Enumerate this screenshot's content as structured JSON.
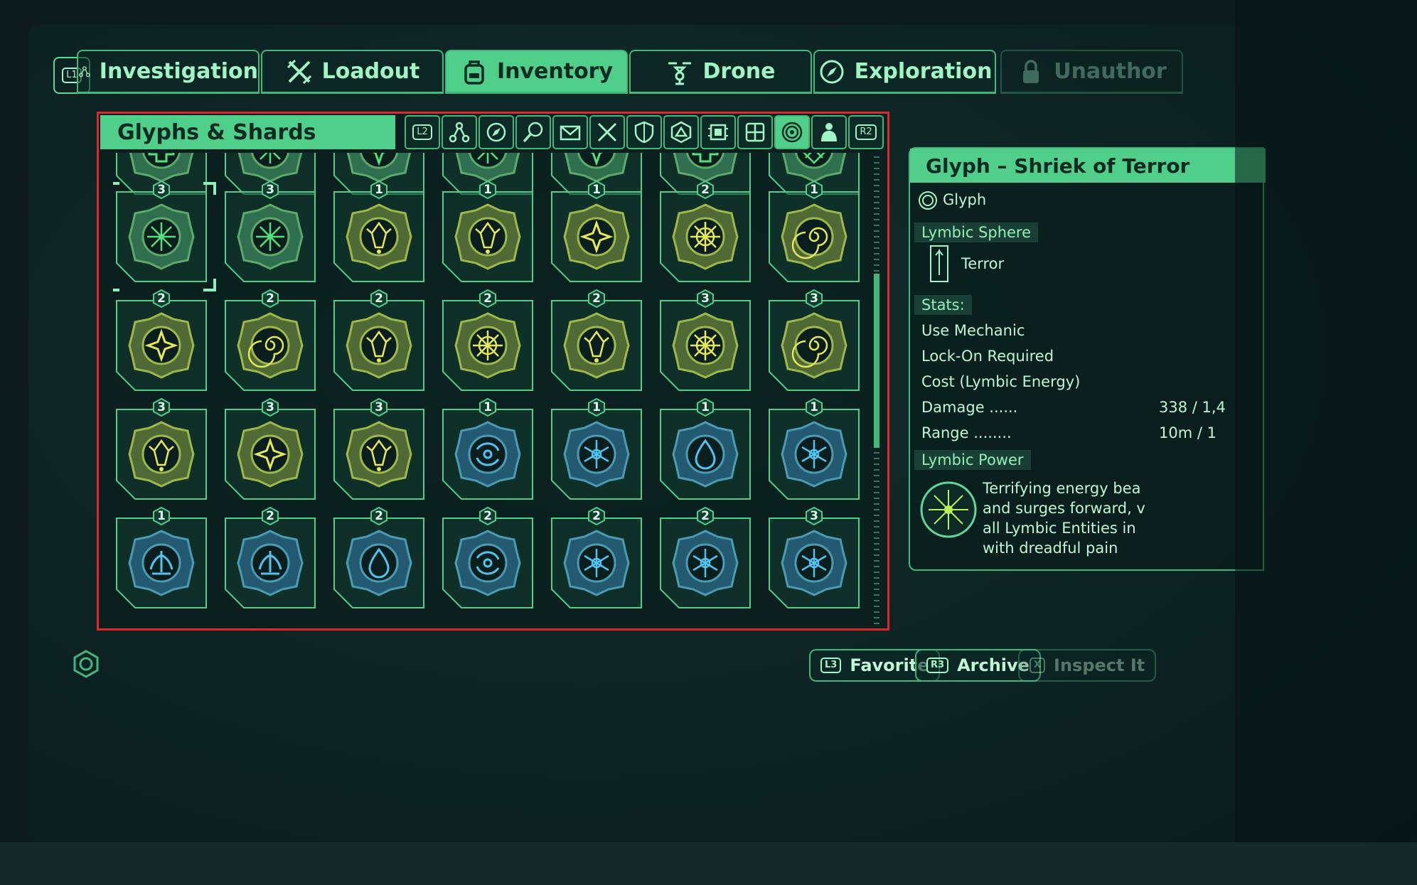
{
  "tabs": [
    {
      "label": "Investigation",
      "icon": "network-icon"
    },
    {
      "label": "Loadout",
      "icon": "crossed-swords-icon"
    },
    {
      "label": "Inventory",
      "icon": "backpack-icon",
      "active": true
    },
    {
      "label": "Drone",
      "icon": "drone-icon"
    },
    {
      "label": "Exploration",
      "icon": "compass-icon"
    },
    {
      "label": "Unauthor",
      "icon": "lock-icon"
    }
  ],
  "l1_label": "L1",
  "panel": {
    "title": "Glyphs & Shards",
    "l2_label": "L2",
    "r2_label": "R2",
    "categories": [
      "network-icon",
      "compass-icon",
      "magnifier-icon",
      "mail-icon",
      "swords-icon",
      "shield-icon",
      "triangle-badge-icon",
      "chip-icon",
      "grid-icon",
      "glyph-ring-icon",
      "figure-icon"
    ],
    "active_category": 9
  },
  "grid": {
    "rows": [
      {
        "counts": [
          null,
          null,
          null,
          null,
          null,
          null,
          null
        ],
        "colors": [
          "green",
          "green",
          "green",
          "green",
          "green",
          "green",
          "green"
        ],
        "symbols": [
          "cross",
          "star",
          "burst",
          "star",
          "burst",
          "cross",
          "diamond"
        ]
      },
      {
        "counts": [
          "3",
          "3",
          "1",
          "1",
          "1",
          "2",
          "1"
        ],
        "colors": [
          "green",
          "green",
          "yellow",
          "yellow",
          "yellow",
          "yellow",
          "yellow"
        ],
        "symbols": [
          "star",
          "star",
          "hand",
          "hand",
          "burst",
          "wheel",
          "spiral"
        ]
      },
      {
        "counts": [
          "2",
          "2",
          "2",
          "2",
          "2",
          "3",
          "3"
        ],
        "colors": [
          "yellow",
          "yellow",
          "yellow",
          "yellow",
          "yellow",
          "yellow",
          "yellow"
        ],
        "symbols": [
          "burst",
          "spiral",
          "hand",
          "wheel",
          "hand",
          "wheel",
          "spiral"
        ]
      },
      {
        "counts": [
          "3",
          "3",
          "3",
          "1",
          "1",
          "1",
          "1"
        ],
        "colors": [
          "yellow",
          "yellow",
          "yellow",
          "blue",
          "blue",
          "blue",
          "blue"
        ],
        "symbols": [
          "hand",
          "burst",
          "hand",
          "swirl",
          "snow",
          "drop",
          "snow"
        ]
      },
      {
        "counts": [
          "1",
          "2",
          "2",
          "2",
          "2",
          "2",
          "3"
        ],
        "colors": [
          "blue",
          "blue",
          "blue",
          "blue",
          "blue",
          "blue",
          "blue"
        ],
        "symbols": [
          "fountain",
          "fountain",
          "drop",
          "swirl",
          "snow",
          "snow",
          "snow"
        ]
      }
    ],
    "selected": {
      "row": 1,
      "col": 0
    },
    "scroll_fraction": 0.37
  },
  "detail": {
    "title": "Glyph – Shriek of Terror",
    "type": "Glyph",
    "sphere": "Lymbic Sphere",
    "sphere_value": "Terror",
    "stats_label": "Stats:",
    "stats": [
      {
        "label": "Use Mechanic",
        "value": ""
      },
      {
        "label": "Lock-On Required",
        "value": ""
      },
      {
        "label": "Cost (Lymbic Energy)",
        "value": ""
      },
      {
        "label": "Damage ......",
        "value": "338 / 1,4"
      },
      {
        "label": "Range ........",
        "value": "10m / 1"
      }
    ],
    "power_label": "Lymbic Power",
    "description": [
      "Terrifying energy bea",
      "and surges forward, v",
      "all Lymbic Entities in",
      "with dreadful pain"
    ]
  },
  "buttons": [
    {
      "badge": "L3",
      "label": "Favorite"
    },
    {
      "badge": "R3",
      "label": "Archive"
    },
    {
      "badge": "X",
      "label": "Inspect It"
    }
  ],
  "colors": {
    "accent": "#4fcf8a",
    "frame": "#3fb87b",
    "selection": "#e1252b",
    "green_gem": "#2f7a55",
    "yellow_gem": "#8fa53a",
    "blue_gem": "#2b6f8f"
  }
}
